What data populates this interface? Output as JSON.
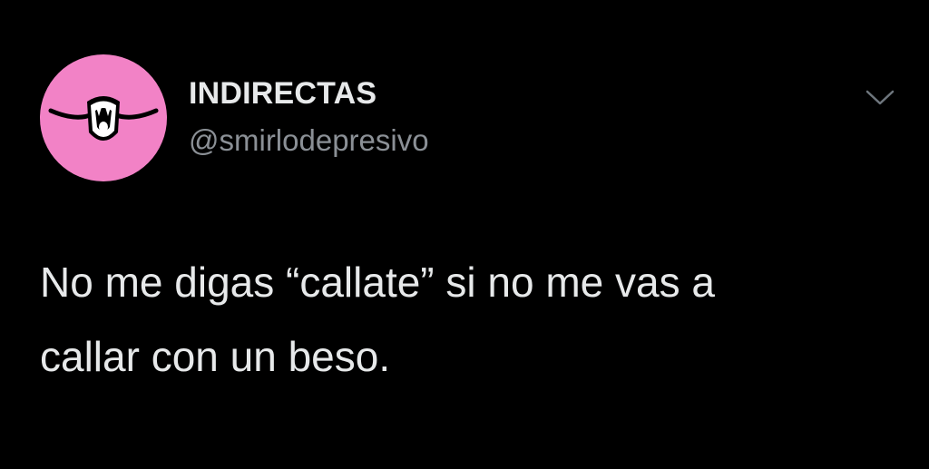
{
  "tweet": {
    "author": {
      "display_name": "INDIRECTAS",
      "handle": "@smirlodepresivo",
      "avatar_icon": "smiling-mouth-logo",
      "avatar_color": "#f282c6"
    },
    "menu_icon": "chevron-down-icon",
    "text_lines": [
      "No me digas “callate” si no me vas a",
      "callar con un beso."
    ]
  },
  "colors": {
    "background": "#000000",
    "primary_text": "#e7e9ea",
    "secondary_text": "#8b9096"
  }
}
